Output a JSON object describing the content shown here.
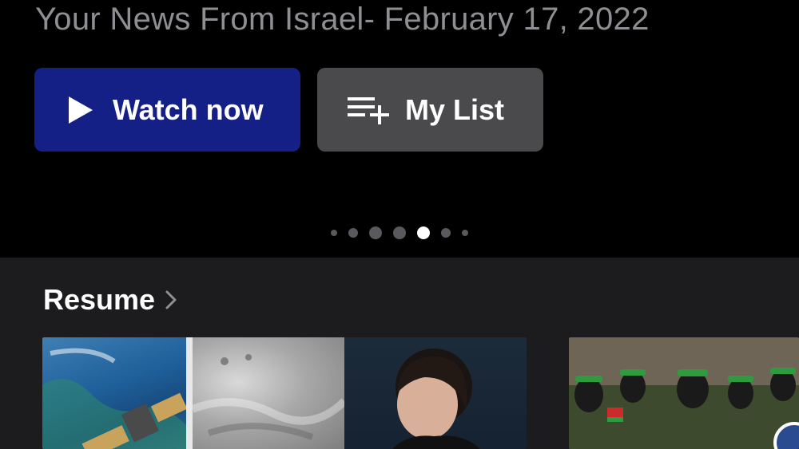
{
  "hero": {
    "title": "Your News From Israel- February 17, 2022",
    "watch_label": "Watch now",
    "list_label": "My List",
    "colors": {
      "watch_bg": "#142086",
      "list_bg": "#4a4a4c"
    },
    "pagination": {
      "total": 7,
      "active_index": 4
    }
  },
  "resume": {
    "title": "Resume",
    "items": [
      {
        "name": "resume-thumbnail-news-panel"
      },
      {
        "name": "resume-thumbnail-crowd"
      }
    ]
  },
  "icons": {
    "play": "play-icon",
    "add_to_list": "playlist-add-icon",
    "chevron": "chevron-right-icon"
  }
}
